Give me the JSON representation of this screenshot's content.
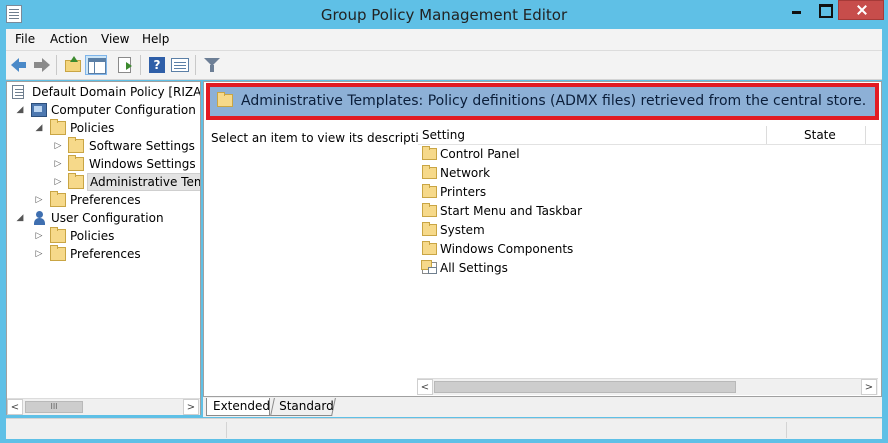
{
  "window": {
    "title": "Group Policy Management Editor",
    "accent_color": "#5fc0e6",
    "close_color": "#c74d4b",
    "title_icon": "policy-doc-icon"
  },
  "menu": {
    "items": [
      "File",
      "Action",
      "View",
      "Help"
    ]
  },
  "toolbar": {
    "buttons": [
      "back-icon",
      "forward-icon",
      "up-folder-icon",
      "show-hide-tree-icon",
      "export-list-icon",
      "help-icon",
      "properties-icon",
      "filter-icon"
    ]
  },
  "tree": {
    "root": "Default Domain Policy [RIZA.CC",
    "computer_configuration": "Computer Configuration",
    "cc_policies": "Policies",
    "software_settings": "Software Settings",
    "windows_settings": "Windows Settings",
    "administrative_templates": "Administrative Temp",
    "cc_preferences": "Preferences",
    "user_configuration": "User Configuration",
    "uc_policies": "Policies",
    "uc_preferences": "Preferences"
  },
  "header": {
    "text": "Administrative Templates: Policy definitions (ADMX files) retrieved from the central store.",
    "band_color": "#8db0d6",
    "highlight_color": "#e21b22"
  },
  "detail": {
    "description": "Select an item to view its description.",
    "columns": [
      "Setting",
      "State"
    ],
    "items": [
      "Control Panel",
      "Network",
      "Printers",
      "Start Menu and Taskbar",
      "System",
      "Windows Components",
      "All Settings"
    ]
  },
  "tabs": {
    "extended": "Extended",
    "standard": "Standard"
  },
  "scrollbar": {
    "grip": "III"
  }
}
